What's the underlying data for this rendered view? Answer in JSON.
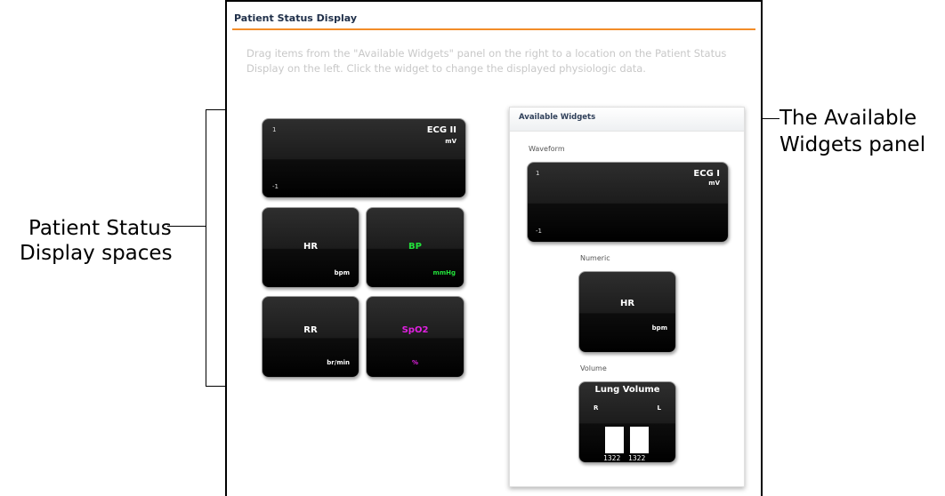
{
  "window": {
    "title": "Patient Status Display",
    "instructions": "Drag items from the \"Available Widgets\" panel on the right to a location on the Patient Status Display on the left. Click the widget to change the displayed physiologic data."
  },
  "display_spaces": {
    "waveform": {
      "max": "1",
      "min": "-1",
      "name": "ECG II",
      "unit": "mV"
    },
    "numerics": [
      {
        "name": "HR",
        "unit": "bpm",
        "color": "#ffffff"
      },
      {
        "name": "BP",
        "unit": "mmHg",
        "color": "#22e03a"
      },
      {
        "name": "RR",
        "unit": "br/min",
        "color": "#ffffff"
      },
      {
        "name": "SpO2",
        "unit": "%",
        "color": "#e020e0"
      }
    ]
  },
  "available_widgets": {
    "title": "Available Widgets",
    "waveform": {
      "section": "Waveform",
      "max": "1",
      "min": "-1",
      "name": "ECG I",
      "unit": "mV"
    },
    "numeric": {
      "section": "Numeric",
      "name": "HR",
      "unit": "bpm"
    },
    "volume": {
      "section": "Volume",
      "name": "Lung Volume",
      "left_label": "R",
      "right_label": "L",
      "left_value": "1322",
      "right_value": "1322"
    }
  },
  "annotations": {
    "left_line1": "Patient Status",
    "left_line2": "Display spaces",
    "right_line1": "The Available",
    "right_line2": "Widgets panel"
  }
}
